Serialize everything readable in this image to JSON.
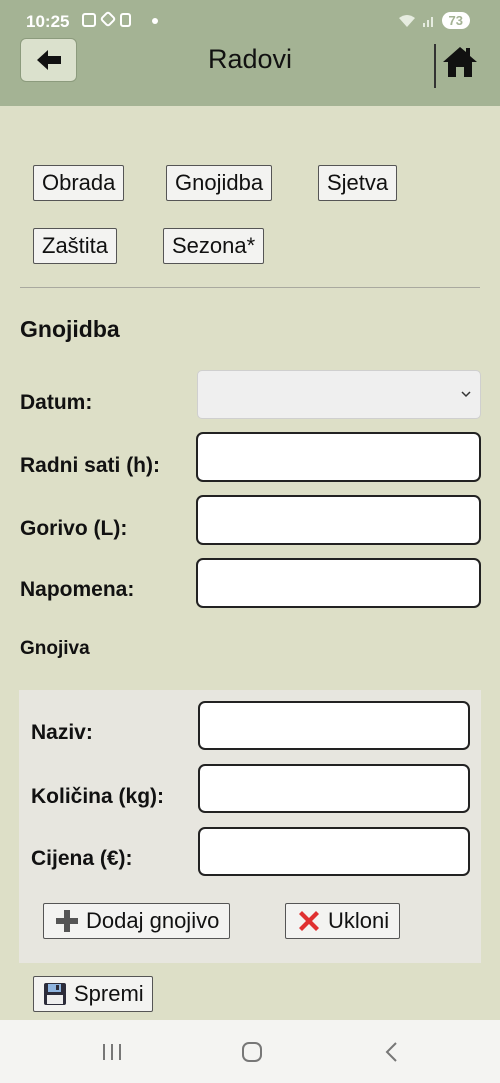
{
  "status": {
    "time": "10:25",
    "battery": "73"
  },
  "header": {
    "title": "Radovi"
  },
  "tabs": {
    "obrada": "Obrada",
    "gnojidba": "Gnojidba",
    "sjetva": "Sjetva",
    "zastita": "Zaštita",
    "sezona": "Sezona*"
  },
  "form": {
    "section_title": "Gnojidba",
    "datum_label": "Datum:",
    "datum_value": "",
    "radni_sati_label": "Radni sati (h):",
    "radni_sati_value": "",
    "gorivo_label": "Gorivo (L):",
    "gorivo_value": "",
    "napomena_label": "Napomena:",
    "napomena_value": ""
  },
  "gnojiva": {
    "heading": "Gnojiva",
    "naziv_label": "Naziv:",
    "naziv_value": "",
    "kolicina_label": "Količina (kg):",
    "kolicina_value": "",
    "cijena_label": "Cijena (€):",
    "cijena_value": "",
    "add_label": "Dodaj gnojivo",
    "remove_label": "Ukloni"
  },
  "actions": {
    "save_label": "Spremi"
  },
  "colors": {
    "header": "#a4b394",
    "background": "#dddfc7",
    "panel": "#e7e6df",
    "remove_icon": "#e03030",
    "add_icon": "#555555"
  },
  "icons": {
    "back": "arrow-left-icon",
    "home": "home-icon",
    "add": "plus-icon",
    "remove": "cross-icon",
    "save": "floppy-disk-icon",
    "select": "chevron-down-icon",
    "nav_recent": "recent-apps-icon",
    "nav_home": "nav-home-icon",
    "nav_back": "nav-back-icon"
  }
}
